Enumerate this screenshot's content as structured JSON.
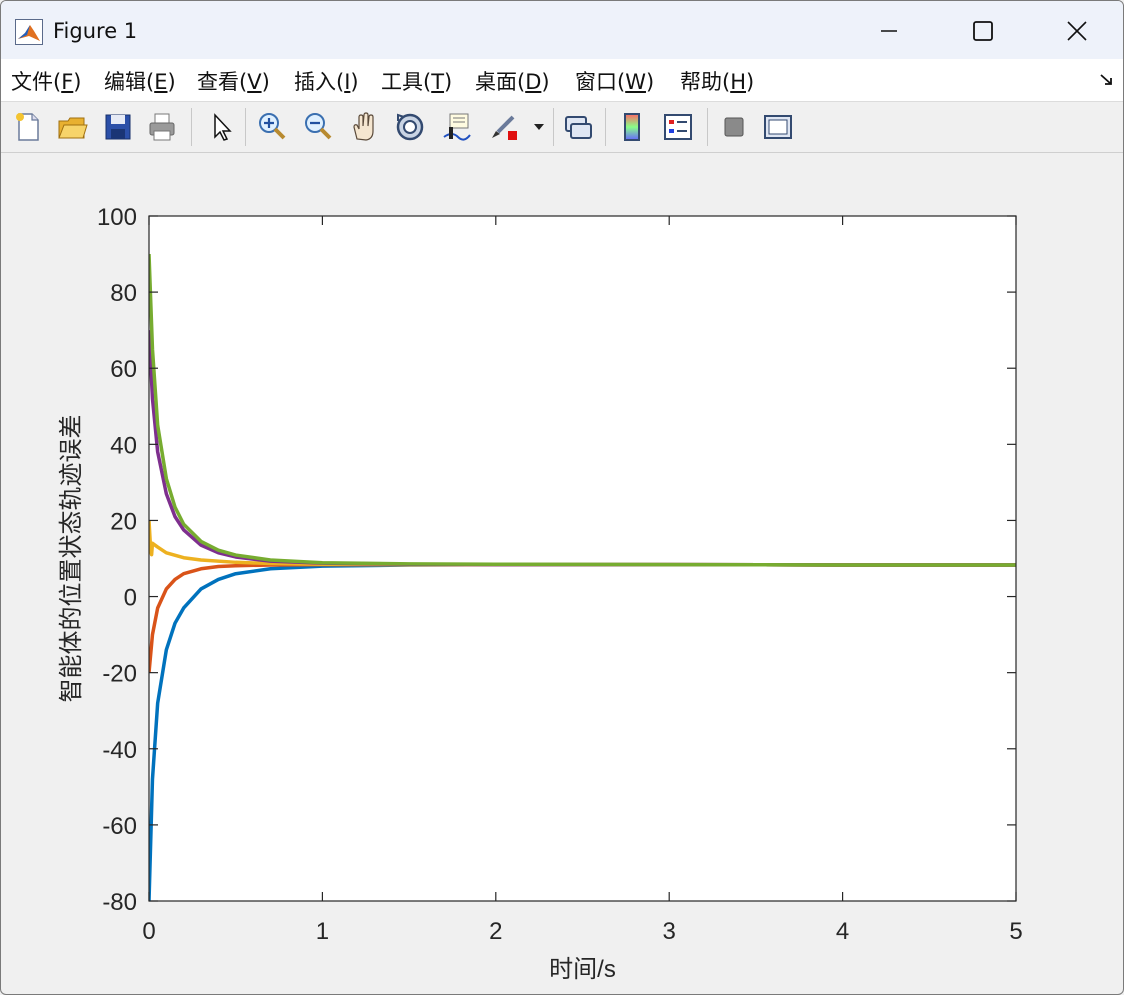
{
  "window": {
    "title": "Figure 1"
  },
  "menu": [
    {
      "text": "文件(",
      "key": "F",
      "tail": ")"
    },
    {
      "text": "编辑(",
      "key": "E",
      "tail": ")"
    },
    {
      "text": "查看(",
      "key": "V",
      "tail": ")"
    },
    {
      "text": "插入(",
      "key": "I",
      "tail": ")"
    },
    {
      "text": "工具(",
      "key": "T",
      "tail": ")"
    },
    {
      "text": "桌面(",
      "key": "D",
      "tail": ")"
    },
    {
      "text": "窗口(",
      "key": "W",
      "tail": ")"
    },
    {
      "text": "帮助(",
      "key": "H",
      "tail": ")"
    }
  ],
  "toolbar": {
    "icons": [
      "new-figure-icon",
      "open-file-icon",
      "save-icon",
      "print-icon",
      "edit-plot-arrow-icon",
      "zoom-in-icon",
      "zoom-out-icon",
      "pan-hand-icon",
      "rotate-3d-icon",
      "data-cursor-icon",
      "brush-icon",
      "brush-dropdown-icon",
      "link-plot-icon",
      "colorbar-icon",
      "legend-icon",
      "hide-plot-tools-icon",
      "show-plot-tools-icon"
    ]
  },
  "chart_data": {
    "type": "line",
    "xlabel": "时间/s",
    "ylabel": "智能体的位置状态轨迹误差",
    "xlim": [
      0,
      5
    ],
    "ylim": [
      -80,
      100
    ],
    "xticks": [
      "0",
      "1",
      "2",
      "3",
      "4",
      "5"
    ],
    "yticks": [
      "-80",
      "-60",
      "-40",
      "-20",
      "0",
      "20",
      "40",
      "60",
      "80",
      "100"
    ],
    "grid": false,
    "series": [
      {
        "color": "#0072BD",
        "x": [
          0,
          0.02,
          0.05,
          0.1,
          0.15,
          0.2,
          0.3,
          0.4,
          0.5,
          0.7,
          1.0,
          1.5,
          2,
          3,
          4,
          5
        ],
        "y": [
          -80,
          -48,
          -28,
          -14,
          -7,
          -3,
          2,
          4.5,
          6,
          7.3,
          8.0,
          8.3,
          8.4,
          8.4,
          8.3,
          8.3
        ]
      },
      {
        "color": "#D95319",
        "x": [
          0,
          0.02,
          0.05,
          0.1,
          0.15,
          0.2,
          0.3,
          0.4,
          0.5,
          0.7,
          1.0,
          1.5,
          2,
          3,
          4,
          5
        ],
        "y": [
          -20,
          -10,
          -3,
          2,
          4.5,
          6,
          7.3,
          7.9,
          8.1,
          8.3,
          8.4,
          8.4,
          8.4,
          8.4,
          8.3,
          8.3
        ]
      },
      {
        "color": "#EDB120",
        "x": [
          0,
          0.01,
          0.015,
          0.02,
          0.05,
          0.1,
          0.2,
          0.3,
          0.5,
          0.7,
          1.0,
          1.5,
          2,
          3,
          4,
          5
        ],
        "y": [
          20,
          12,
          11,
          14,
          13,
          11.5,
          10.2,
          9.6,
          9.0,
          8.7,
          8.5,
          8.4,
          8.4,
          8.4,
          8.3,
          8.3
        ]
      },
      {
        "color": "#7E2F8E",
        "x": [
          0,
          0.02,
          0.05,
          0.1,
          0.15,
          0.2,
          0.3,
          0.4,
          0.5,
          0.7,
          1.0,
          1.5,
          2,
          3,
          4,
          5
        ],
        "y": [
          70,
          52,
          38,
          27,
          21,
          17.5,
          13.5,
          11.5,
          10.4,
          9.3,
          8.8,
          8.5,
          8.4,
          8.4,
          8.3,
          8.3
        ]
      },
      {
        "color": "#77AC30",
        "x": [
          0,
          0.02,
          0.05,
          0.1,
          0.15,
          0.2,
          0.3,
          0.4,
          0.5,
          0.7,
          1.0,
          1.5,
          2,
          3,
          4,
          5
        ],
        "y": [
          90,
          65,
          45,
          31,
          23.5,
          19,
          14.5,
          12.2,
          10.9,
          9.6,
          8.9,
          8.6,
          8.5,
          8.4,
          8.3,
          8.3
        ]
      }
    ]
  }
}
